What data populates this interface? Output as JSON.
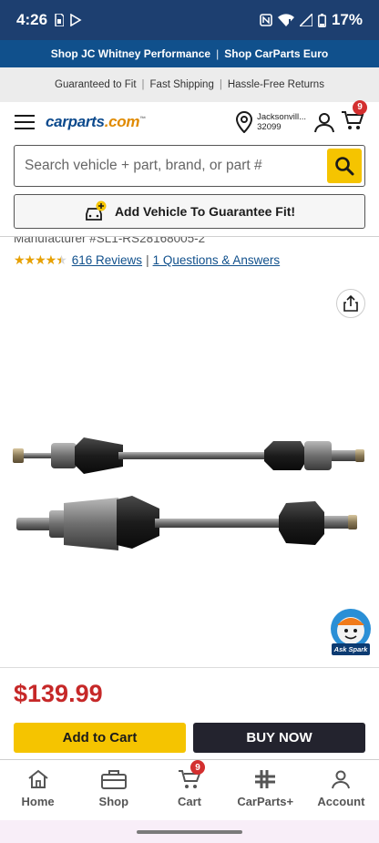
{
  "status_bar": {
    "time": "4:26",
    "battery": "17%"
  },
  "promo": {
    "link1": "Shop JC Whitney Performance",
    "sep": "|",
    "link2": "Shop CarParts Euro"
  },
  "guarantee": {
    "item1": "Guaranteed to Fit",
    "item2": "Fast Shipping",
    "item3": "Hassle-Free Returns",
    "sep": "|"
  },
  "header": {
    "logo_main": "carparts",
    "logo_suffix": ".com",
    "logo_tm": "™",
    "location_line1": "Jacksonvill...",
    "location_line2": "32099",
    "cart_count": "9"
  },
  "search": {
    "placeholder": "Search vehicle + part, brand, or part #"
  },
  "add_vehicle": {
    "label": "Add Vehicle To Guarantee Fit!"
  },
  "product": {
    "manufacturer_partial": "Manufacturer #SL1-RS28168005-2",
    "rating": 4.5,
    "stars": "★★★★★",
    "reviews_link": "616 Reviews",
    "qa_link": "1 Questions & Answers",
    "rating_sep": "|",
    "price": "$139.99"
  },
  "ask_spark": {
    "label": "Ask Spark"
  },
  "actions": {
    "add_to_cart": "Add to Cart",
    "buy_now": "BUY NOW"
  },
  "tabs": [
    {
      "label": "Home",
      "icon": "home-icon"
    },
    {
      "label": "Shop",
      "icon": "toolbox-icon"
    },
    {
      "label": "Cart",
      "icon": "cart-icon",
      "badge": "9"
    },
    {
      "label": "CarParts+",
      "icon": "carparts-plus-icon"
    },
    {
      "label": "Account",
      "icon": "account-icon"
    }
  ],
  "colors": {
    "brand_blue": "#10508c",
    "accent_yellow": "#f5c400",
    "price_red": "#c62828",
    "buy_dark": "#23232e"
  }
}
